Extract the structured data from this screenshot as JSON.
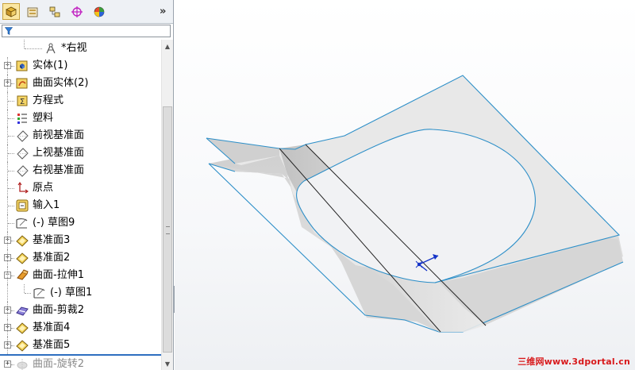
{
  "toolbar": {
    "tabs": [
      {
        "icon": "feature-manager-icon",
        "active": true
      },
      {
        "icon": "property-manager-icon",
        "active": false
      },
      {
        "icon": "configuration-manager-icon",
        "active": false
      },
      {
        "icon": "dimxpert-manager-icon",
        "active": false
      },
      {
        "icon": "display-manager-icon",
        "active": false
      }
    ],
    "more": "»"
  },
  "filter": {
    "icon": "filter-icon",
    "value": ""
  },
  "tree": {
    "items": [
      {
        "label": "*右视",
        "icon": "named-view-icon",
        "expander": "none"
      },
      {
        "label": "实体(1)",
        "icon": "solid-bodies-folder-icon",
        "expander": "+"
      },
      {
        "label": "曲面实体(2)",
        "icon": "surface-bodies-folder-icon",
        "expander": "+"
      },
      {
        "label": "方程式",
        "icon": "equations-icon",
        "expander": "none"
      },
      {
        "label": "塑料",
        "icon": "material-icon",
        "expander": "none"
      },
      {
        "label": "前视基准面",
        "icon": "plane-icon",
        "expander": "none"
      },
      {
        "label": "上视基准面",
        "icon": "plane-icon",
        "expander": "none"
      },
      {
        "label": "右视基准面",
        "icon": "plane-icon",
        "expander": "none"
      },
      {
        "label": "原点",
        "icon": "origin-icon",
        "expander": "none"
      },
      {
        "label": "输入1",
        "icon": "imported-feature-icon",
        "expander": "none"
      },
      {
        "label": "(-) 草图9",
        "icon": "sketch-icon",
        "expander": "none"
      },
      {
        "label": "基准面3",
        "icon": "ref-plane-icon",
        "expander": "+"
      },
      {
        "label": "基准面2",
        "icon": "ref-plane-icon",
        "expander": "+"
      },
      {
        "label": "曲面-拉伸1",
        "icon": "surface-extrude-icon",
        "expander": "-"
      },
      {
        "label": "(-) 草图1",
        "icon": "sketch-icon",
        "expander": "child"
      },
      {
        "label": "曲面-剪裁2",
        "icon": "surface-trim-icon",
        "expander": "+"
      },
      {
        "label": "基准面4",
        "icon": "ref-plane-icon",
        "expander": "+"
      },
      {
        "label": "基准面5",
        "icon": "ref-plane-icon",
        "expander": "+"
      },
      {
        "label": "曲面-旋转2",
        "icon": "surface-revolve-icon",
        "expander": "+",
        "suppressed": true
      }
    ]
  },
  "viewport": {
    "triad_icon": "coordinate-triad-icon"
  },
  "watermark": "三维网www.3dportal.cn",
  "colors": {
    "edge": "#2d8fc8",
    "surface": "#ebebeb",
    "surface_shadow": "#c2c2c2",
    "accent": "#1534c8",
    "watermark": "#d8191b"
  }
}
